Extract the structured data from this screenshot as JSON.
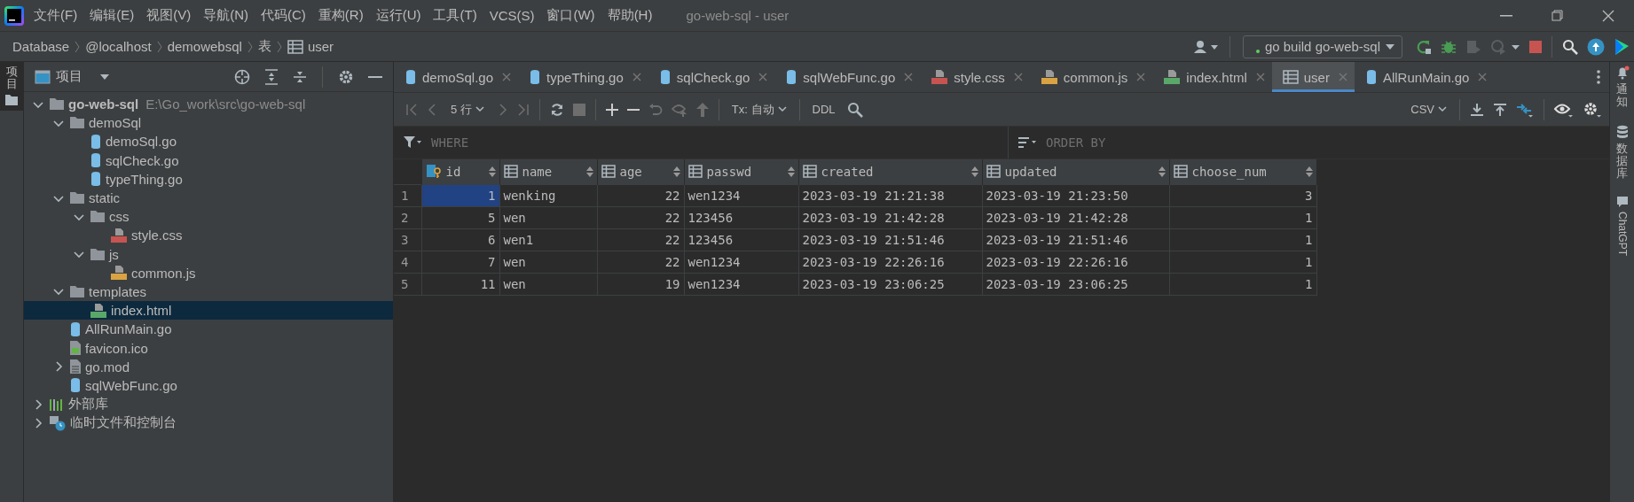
{
  "window": {
    "title": "go-web-sql - user"
  },
  "menu_bar": [
    "文件(F)",
    "编辑(E)",
    "视图(V)",
    "导航(N)",
    "代码(C)",
    "重构(R)",
    "运行(U)",
    "工具(T)",
    "VCS(S)",
    "窗口(W)",
    "帮助(H)"
  ],
  "breadcrumbs": [
    {
      "label": "Database",
      "kind": "text"
    },
    {
      "label": "@localhost",
      "kind": "text"
    },
    {
      "label": "demowebsql",
      "kind": "text"
    },
    {
      "label": "表",
      "kind": "text"
    },
    {
      "label": "user",
      "kind": "table"
    }
  ],
  "run_config": "go build go-web-sql",
  "left_strip": [
    {
      "label": "项目",
      "selected": true
    }
  ],
  "project_panel": {
    "title": "项目",
    "tree": [
      {
        "label": "go-web-sql",
        "path": "E:\\Go_work\\src\\go-web-sql",
        "kind": "project",
        "expanded": true,
        "selected": false,
        "children": [
          {
            "label": "demoSql",
            "kind": "folder",
            "expanded": true,
            "selected": false,
            "children": [
              {
                "label": "demoSql.go",
                "kind": "go",
                "selected": false
              },
              {
                "label": "sqlCheck.go",
                "kind": "go",
                "selected": false
              },
              {
                "label": "typeThing.go",
                "kind": "go",
                "selected": false
              }
            ]
          },
          {
            "label": "static",
            "kind": "folder",
            "expanded": true,
            "selected": false,
            "children": [
              {
                "label": "css",
                "kind": "folder",
                "expanded": true,
                "selected": false,
                "children": [
                  {
                    "label": "style.css",
                    "kind": "css",
                    "selected": false
                  }
                ]
              },
              {
                "label": "js",
                "kind": "folder",
                "expanded": true,
                "selected": false,
                "children": [
                  {
                    "label": "common.js",
                    "kind": "js",
                    "selected": false
                  }
                ]
              }
            ]
          },
          {
            "label": "templates",
            "kind": "folder",
            "expanded": true,
            "selected": false,
            "children": [
              {
                "label": "index.html",
                "kind": "html",
                "selected": true
              }
            ]
          },
          {
            "label": "AllRunMain.go",
            "kind": "go",
            "selected": false
          },
          {
            "label": "favicon.ico",
            "kind": "ico",
            "selected": false
          },
          {
            "label": "go.mod",
            "kind": "mod",
            "expanded": false,
            "selected": false
          },
          {
            "label": "sqlWebFunc.go",
            "kind": "go",
            "selected": false
          }
        ]
      },
      {
        "label": "外部库",
        "kind": "lib",
        "expanded": false,
        "selected": false
      },
      {
        "label": "临时文件和控制台",
        "kind": "scratch",
        "expanded": false,
        "selected": false
      }
    ]
  },
  "tabs": [
    {
      "label": "demoSql.go",
      "kind": "go",
      "selected": false
    },
    {
      "label": "typeThing.go",
      "kind": "go",
      "selected": false
    },
    {
      "label": "sqlCheck.go",
      "kind": "go",
      "selected": false
    },
    {
      "label": "sqlWebFunc.go",
      "kind": "go",
      "selected": false
    },
    {
      "label": "style.css",
      "kind": "css",
      "selected": false
    },
    {
      "label": "common.js",
      "kind": "js",
      "selected": false
    },
    {
      "label": "index.html",
      "kind": "html",
      "selected": false
    },
    {
      "label": "user",
      "kind": "table",
      "selected": true
    },
    {
      "label": "AllRunMain.go",
      "kind": "go",
      "selected": false
    }
  ],
  "data_toolbar": {
    "row_count": "5 行",
    "transaction": "Tx: 自动",
    "ddl": "DDL",
    "export_format": "CSV"
  },
  "filter": {
    "where_placeholder": "WHERE",
    "order_by_placeholder": "ORDER BY"
  },
  "table": {
    "columns": [
      {
        "label": "id",
        "primary_key": true,
        "kind": "number"
      },
      {
        "label": "name",
        "primary_key": false,
        "kind": "text"
      },
      {
        "label": "age",
        "primary_key": false,
        "kind": "number"
      },
      {
        "label": "passwd",
        "primary_key": false,
        "kind": "text"
      },
      {
        "label": "created",
        "primary_key": false,
        "kind": "text"
      },
      {
        "label": "updated",
        "primary_key": false,
        "kind": "text"
      },
      {
        "label": "choose_num",
        "primary_key": false,
        "kind": "number"
      }
    ],
    "rows": [
      {
        "number": "1",
        "selected": true,
        "cells": [
          "1",
          "wenking",
          "22",
          "wen1234",
          "2023-03-19 21:21:38",
          "2023-03-19 21:23:50",
          "3"
        ]
      },
      {
        "number": "2",
        "selected": false,
        "cells": [
          "5",
          "wen",
          "22",
          "123456",
          "2023-03-19 21:42:28",
          "2023-03-19 21:42:28",
          "1"
        ]
      },
      {
        "number": "3",
        "selected": false,
        "cells": [
          "6",
          "wen1",
          "22",
          "123456",
          "2023-03-19 21:51:46",
          "2023-03-19 21:51:46",
          "1"
        ]
      },
      {
        "number": "4",
        "selected": false,
        "cells": [
          "7",
          "wen",
          "22",
          "wen1234",
          "2023-03-19 22:26:16",
          "2023-03-19 22:26:16",
          "1"
        ]
      },
      {
        "number": "5",
        "selected": false,
        "cells": [
          "11",
          "wen",
          "19",
          "wen1234",
          "2023-03-19 23:06:25",
          "2023-03-19 23:06:25",
          "1"
        ]
      }
    ]
  },
  "right_strip": [
    {
      "label": "通知",
      "kind": "bell"
    },
    {
      "label": "数据库",
      "kind": "database"
    },
    {
      "label": "ChatGPT",
      "kind": "chat"
    }
  ]
}
